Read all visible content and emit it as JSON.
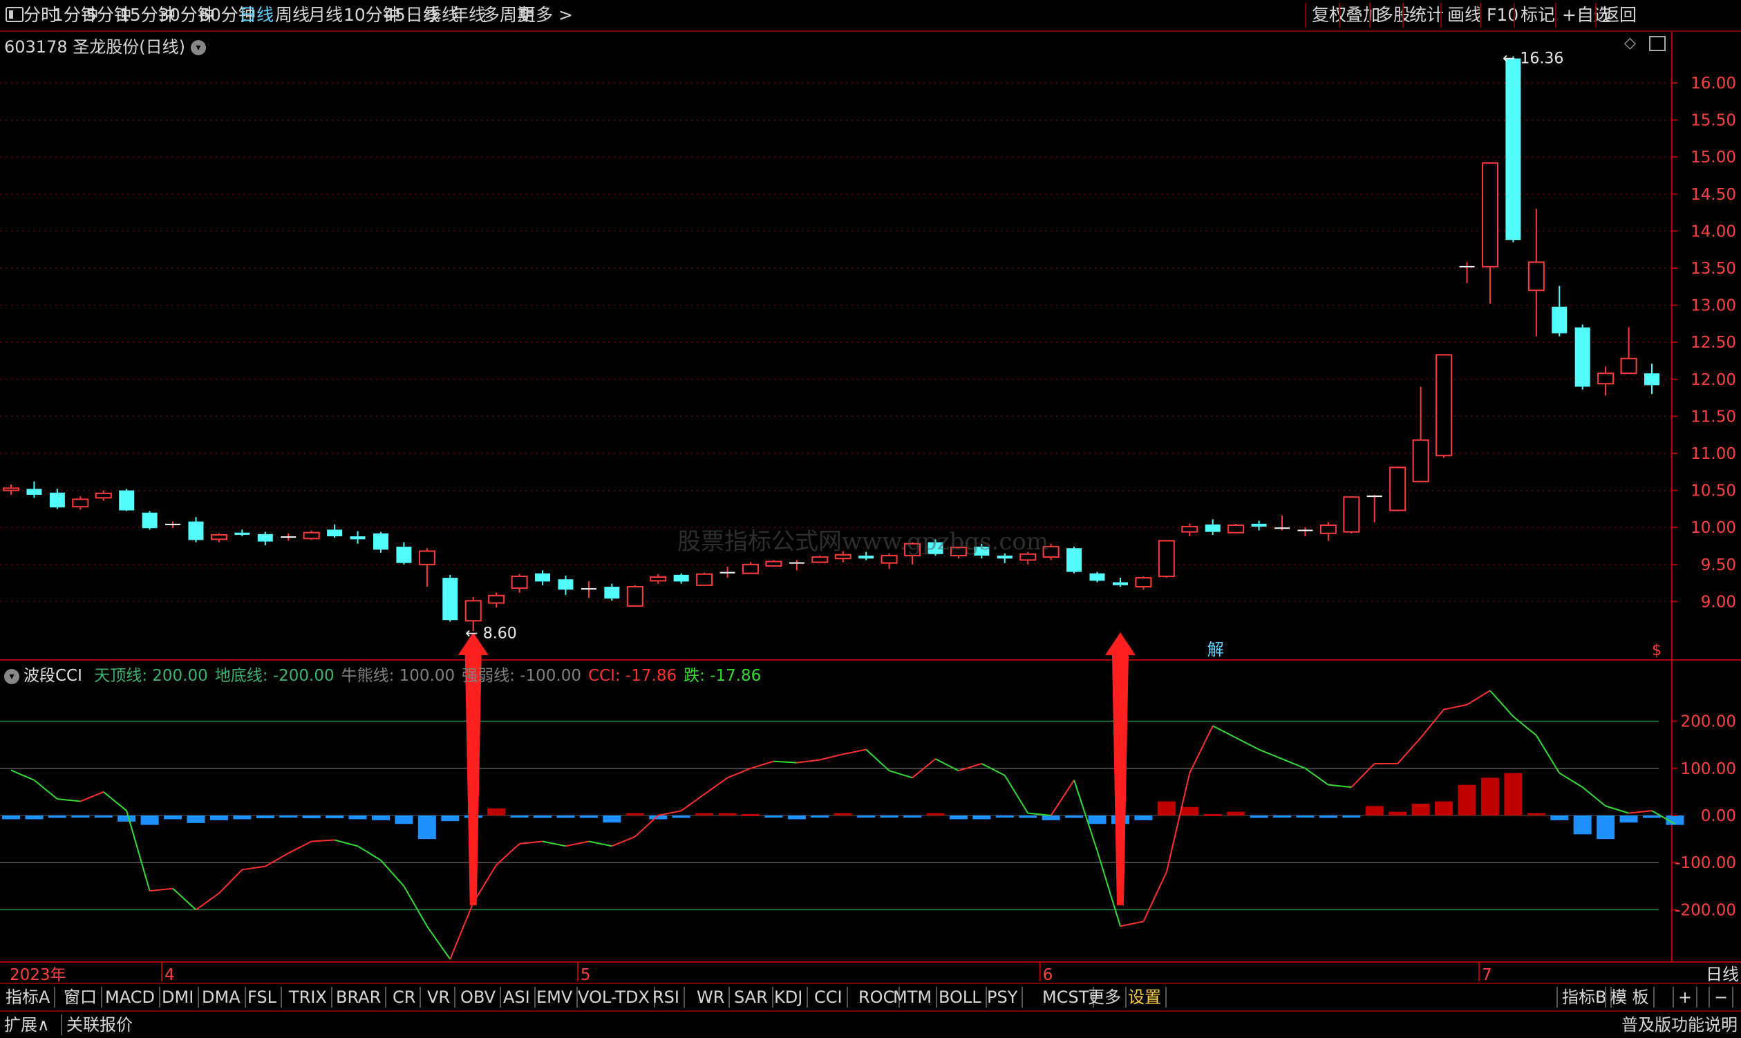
{
  "toolbar": {
    "periods": [
      "分时",
      "1分钟",
      "5分钟",
      "15分钟",
      "30分钟",
      "60分钟",
      "日线",
      "周线",
      "月线",
      "10分钟",
      "45日线",
      "季线",
      "年线",
      "多周期",
      "更多 >"
    ],
    "active_period": "日线",
    "right_buttons": [
      "复权",
      "叠加",
      "多股",
      "统计",
      "画线",
      "F10",
      "标记",
      "+自选",
      "返回"
    ]
  },
  "stock": {
    "title": "603178 圣龙股份(日线)"
  },
  "watermark": "股票指标公式网www.gpzbgs.com",
  "annotations": {
    "high_label": "16.36",
    "low_label": "8.60",
    "jie_marker": "解",
    "s_marker": "$"
  },
  "indicator": {
    "name": "波段CCI",
    "legend": [
      {
        "label": "天顶线: 200.00",
        "color": "#3cb371"
      },
      {
        "label": "地底线: -200.00",
        "color": "#3cb371"
      },
      {
        "label": "牛熊线: 100.00",
        "color": "#808080"
      },
      {
        "label": "强弱线: -100.00",
        "color": "#808080"
      },
      {
        "label": "CCI: -17.86",
        "color": "#ff3030"
      },
      {
        "label": "跌: -17.86",
        "color": "#32dc32"
      }
    ]
  },
  "time_axis": {
    "labels": [
      "2023年",
      "4",
      "5",
      "6",
      "7"
    ],
    "right_label": "日线"
  },
  "bottom_tabs": [
    "指标A",
    "窗口",
    "MACD",
    "DMI",
    "DMA",
    "FSL",
    "TRIX",
    "BRAR",
    "CR",
    "VR",
    "OBV",
    "ASI",
    "EMV",
    "VOL-TDX",
    "RSI",
    "WR",
    "SAR",
    "KDJ",
    "CCI",
    "ROC",
    "MTM",
    "BOLL",
    "PSY",
    "MCST",
    "更多",
    "设置"
  ],
  "bottom_right": [
    "指标B",
    "模 板",
    "+",
    "−"
  ],
  "status_bar": {
    "left": [
      "扩展∧",
      "关联报价"
    ],
    "right": "普及版功能说明"
  },
  "chart_data": [
    {
      "type": "candlestick",
      "title": "603178 圣龙股份(日线)",
      "y_ticks": [
        9.0,
        9.5,
        10.0,
        10.5,
        11.0,
        11.5,
        12.0,
        12.5,
        13.0,
        13.5,
        14.0,
        14.5,
        15.0,
        15.5,
        16.0
      ],
      "ylim": [
        8.3,
        16.55
      ],
      "candles": [
        {
          "o": 10.5,
          "h": 10.58,
          "l": 10.44,
          "c": 10.53
        },
        {
          "o": 10.52,
          "h": 10.62,
          "l": 10.4,
          "c": 10.44
        },
        {
          "o": 10.47,
          "h": 10.52,
          "l": 10.25,
          "c": 10.27
        },
        {
          "o": 10.28,
          "h": 10.42,
          "l": 10.24,
          "c": 10.38
        },
        {
          "o": 10.4,
          "h": 10.5,
          "l": 10.36,
          "c": 10.46
        },
        {
          "o": 10.5,
          "h": 10.52,
          "l": 10.22,
          "c": 10.23
        },
        {
          "o": 10.2,
          "h": 10.22,
          "l": 9.97,
          "c": 9.99
        },
        {
          "o": 10.02,
          "h": 10.08,
          "l": 9.99,
          "c": 10.04
        },
        {
          "o": 10.08,
          "h": 10.14,
          "l": 9.8,
          "c": 9.83
        },
        {
          "o": 9.84,
          "h": 9.92,
          "l": 9.8,
          "c": 9.9
        },
        {
          "o": 9.93,
          "h": 9.97,
          "l": 9.88,
          "c": 9.9
        },
        {
          "o": 9.91,
          "h": 9.94,
          "l": 9.76,
          "c": 9.81
        },
        {
          "o": 9.86,
          "h": 9.92,
          "l": 9.82,
          "c": 9.87
        },
        {
          "o": 9.85,
          "h": 9.96,
          "l": 9.83,
          "c": 9.93
        },
        {
          "o": 9.97,
          "h": 10.04,
          "l": 9.86,
          "c": 9.88
        },
        {
          "o": 9.88,
          "h": 9.95,
          "l": 9.78,
          "c": 9.84
        },
        {
          "o": 9.92,
          "h": 9.94,
          "l": 9.66,
          "c": 9.7
        },
        {
          "o": 9.74,
          "h": 9.8,
          "l": 9.5,
          "c": 9.52
        },
        {
          "o": 9.5,
          "h": 9.72,
          "l": 9.2,
          "c": 9.68
        },
        {
          "o": 9.32,
          "h": 9.36,
          "l": 8.73,
          "c": 8.75
        },
        {
          "o": 8.74,
          "h": 9.06,
          "l": 8.6,
          "c": 9.01
        },
        {
          "o": 8.98,
          "h": 9.12,
          "l": 8.92,
          "c": 9.08
        },
        {
          "o": 9.18,
          "h": 9.37,
          "l": 9.12,
          "c": 9.34
        },
        {
          "o": 9.38,
          "h": 9.42,
          "l": 9.22,
          "c": 9.27
        },
        {
          "o": 9.3,
          "h": 9.35,
          "l": 9.09,
          "c": 9.16
        },
        {
          "o": 9.17,
          "h": 9.27,
          "l": 9.05,
          "c": 9.17
        },
        {
          "o": 9.2,
          "h": 9.24,
          "l": 9.01,
          "c": 9.04
        },
        {
          "o": 8.94,
          "h": 9.22,
          "l": 8.93,
          "c": 9.2
        },
        {
          "o": 9.28,
          "h": 9.37,
          "l": 9.24,
          "c": 9.33
        },
        {
          "o": 9.36,
          "h": 9.38,
          "l": 9.24,
          "c": 9.27
        },
        {
          "o": 9.22,
          "h": 9.39,
          "l": 9.21,
          "c": 9.37
        },
        {
          "o": 9.38,
          "h": 9.47,
          "l": 9.32,
          "c": 9.39
        },
        {
          "o": 9.38,
          "h": 9.53,
          "l": 9.37,
          "c": 9.5
        },
        {
          "o": 9.48,
          "h": 9.56,
          "l": 9.47,
          "c": 9.54
        },
        {
          "o": 9.52,
          "h": 9.56,
          "l": 9.42,
          "c": 9.52
        },
        {
          "o": 9.53,
          "h": 9.62,
          "l": 9.52,
          "c": 9.6
        },
        {
          "o": 9.58,
          "h": 9.68,
          "l": 9.53,
          "c": 9.63
        },
        {
          "o": 9.62,
          "h": 9.67,
          "l": 9.56,
          "c": 9.58
        },
        {
          "o": 9.52,
          "h": 9.65,
          "l": 9.44,
          "c": 9.62
        },
        {
          "o": 9.62,
          "h": 9.8,
          "l": 9.5,
          "c": 9.78
        },
        {
          "o": 9.8,
          "h": 9.84,
          "l": 9.62,
          "c": 9.64
        },
        {
          "o": 9.62,
          "h": 9.74,
          "l": 9.58,
          "c": 9.73
        },
        {
          "o": 9.74,
          "h": 9.78,
          "l": 9.58,
          "c": 9.62
        },
        {
          "o": 9.62,
          "h": 9.65,
          "l": 9.52,
          "c": 9.58
        },
        {
          "o": 9.56,
          "h": 9.67,
          "l": 9.5,
          "c": 9.64
        },
        {
          "o": 9.6,
          "h": 9.78,
          "l": 9.56,
          "c": 9.74
        },
        {
          "o": 9.72,
          "h": 9.74,
          "l": 9.38,
          "c": 9.4
        },
        {
          "o": 9.38,
          "h": 9.4,
          "l": 9.26,
          "c": 9.28
        },
        {
          "o": 9.26,
          "h": 9.32,
          "l": 9.2,
          "c": 9.22
        },
        {
          "o": 9.2,
          "h": 9.34,
          "l": 9.16,
          "c": 9.32
        },
        {
          "o": 9.34,
          "h": 9.83,
          "l": 9.32,
          "c": 9.82
        },
        {
          "o": 9.94,
          "h": 10.05,
          "l": 9.88,
          "c": 10.01
        },
        {
          "o": 10.04,
          "h": 10.11,
          "l": 9.9,
          "c": 9.94
        },
        {
          "o": 9.93,
          "h": 10.05,
          "l": 9.92,
          "c": 10.03
        },
        {
          "o": 10.05,
          "h": 10.09,
          "l": 9.96,
          "c": 10.01
        },
        {
          "o": 9.97,
          "h": 10.16,
          "l": 9.96,
          "c": 9.99
        },
        {
          "o": 9.96,
          "h": 10.0,
          "l": 9.88,
          "c": 9.96
        },
        {
          "o": 9.92,
          "h": 10.07,
          "l": 9.82,
          "c": 10.03
        },
        {
          "o": 9.94,
          "h": 10.42,
          "l": 9.92,
          "c": 10.41
        },
        {
          "o": 10.42,
          "h": 10.44,
          "l": 10.07,
          "c": 10.42
        },
        {
          "o": 10.23,
          "h": 10.82,
          "l": 10.22,
          "c": 10.81
        },
        {
          "o": 10.62,
          "h": 11.9,
          "l": 10.61,
          "c": 11.18
        },
        {
          "o": 10.97,
          "h": 12.34,
          "l": 10.94,
          "c": 12.33
        },
        {
          "o": 13.52,
          "h": 13.58,
          "l": 13.3,
          "c": 13.52
        },
        {
          "o": 13.52,
          "h": 14.92,
          "l": 13.02,
          "c": 14.92
        },
        {
          "o": 16.33,
          "h": 16.36,
          "l": 13.85,
          "c": 13.88
        },
        {
          "o": 13.2,
          "h": 14.3,
          "l": 12.58,
          "c": 13.58
        },
        {
          "o": 12.98,
          "h": 13.26,
          "l": 12.58,
          "c": 12.62
        },
        {
          "o": 12.7,
          "h": 12.74,
          "l": 11.86,
          "c": 11.9
        },
        {
          "o": 11.94,
          "h": 12.17,
          "l": 11.78,
          "c": 12.08
        },
        {
          "o": 12.08,
          "h": 12.7,
          "l": 12.07,
          "c": 12.28
        },
        {
          "o": 12.08,
          "h": 12.21,
          "l": 11.8,
          "c": 11.92
        }
      ]
    },
    {
      "type": "line+bar",
      "title": "波段CCI",
      "y_ticks": [
        -200.0,
        -100.0,
        0.0,
        100.0,
        200.0
      ],
      "ylim": [
        -330,
        330
      ],
      "reference_lines": [
        {
          "name": "天顶线",
          "value": 200
        },
        {
          "name": "地底线",
          "value": -200
        },
        {
          "name": "牛熊线",
          "value": 100
        },
        {
          "name": "强弱线",
          "value": -100
        }
      ],
      "cci": [
        96,
        75,
        35,
        30,
        50,
        10,
        -160,
        -155,
        -200,
        -165,
        -115,
        -108,
        -80,
        -55,
        -52,
        -65,
        -95,
        -150,
        -235,
        -305,
        -185,
        -105,
        -60,
        -55,
        -65,
        -55,
        -65,
        -45,
        0,
        10,
        45,
        80,
        100,
        115,
        112,
        118,
        130,
        140,
        95,
        80,
        120,
        95,
        110,
        85,
        5,
        0,
        75,
        -75,
        -235,
        -225,
        -120,
        90,
        190,
        165,
        140,
        120,
        100,
        65,
        60,
        110,
        110,
        165,
        225,
        235,
        265,
        210,
        170,
        90,
        60,
        20,
        5,
        10,
        -17.86
      ],
      "bars": [
        -8,
        -8,
        -5,
        -3,
        -3,
        -13,
        -20,
        -8,
        -16,
        -10,
        -8,
        -6,
        -4,
        -6,
        -6,
        -8,
        -10,
        -18,
        -50,
        -12,
        -5,
        15,
        -3,
        -5,
        -5,
        -5,
        -15,
        5,
        -8,
        -5,
        5,
        5,
        3,
        -3,
        -8,
        -4,
        5,
        -3,
        -3,
        -3,
        5,
        -8,
        -8,
        -3,
        -5,
        -10,
        -5,
        -18,
        -18,
        -10,
        30,
        18,
        3,
        8,
        -5,
        -3,
        -3,
        -5,
        -3,
        20,
        8,
        25,
        30,
        65,
        80,
        90,
        5,
        -10,
        -40,
        -50,
        -15,
        -5,
        -20
      ]
    }
  ]
}
